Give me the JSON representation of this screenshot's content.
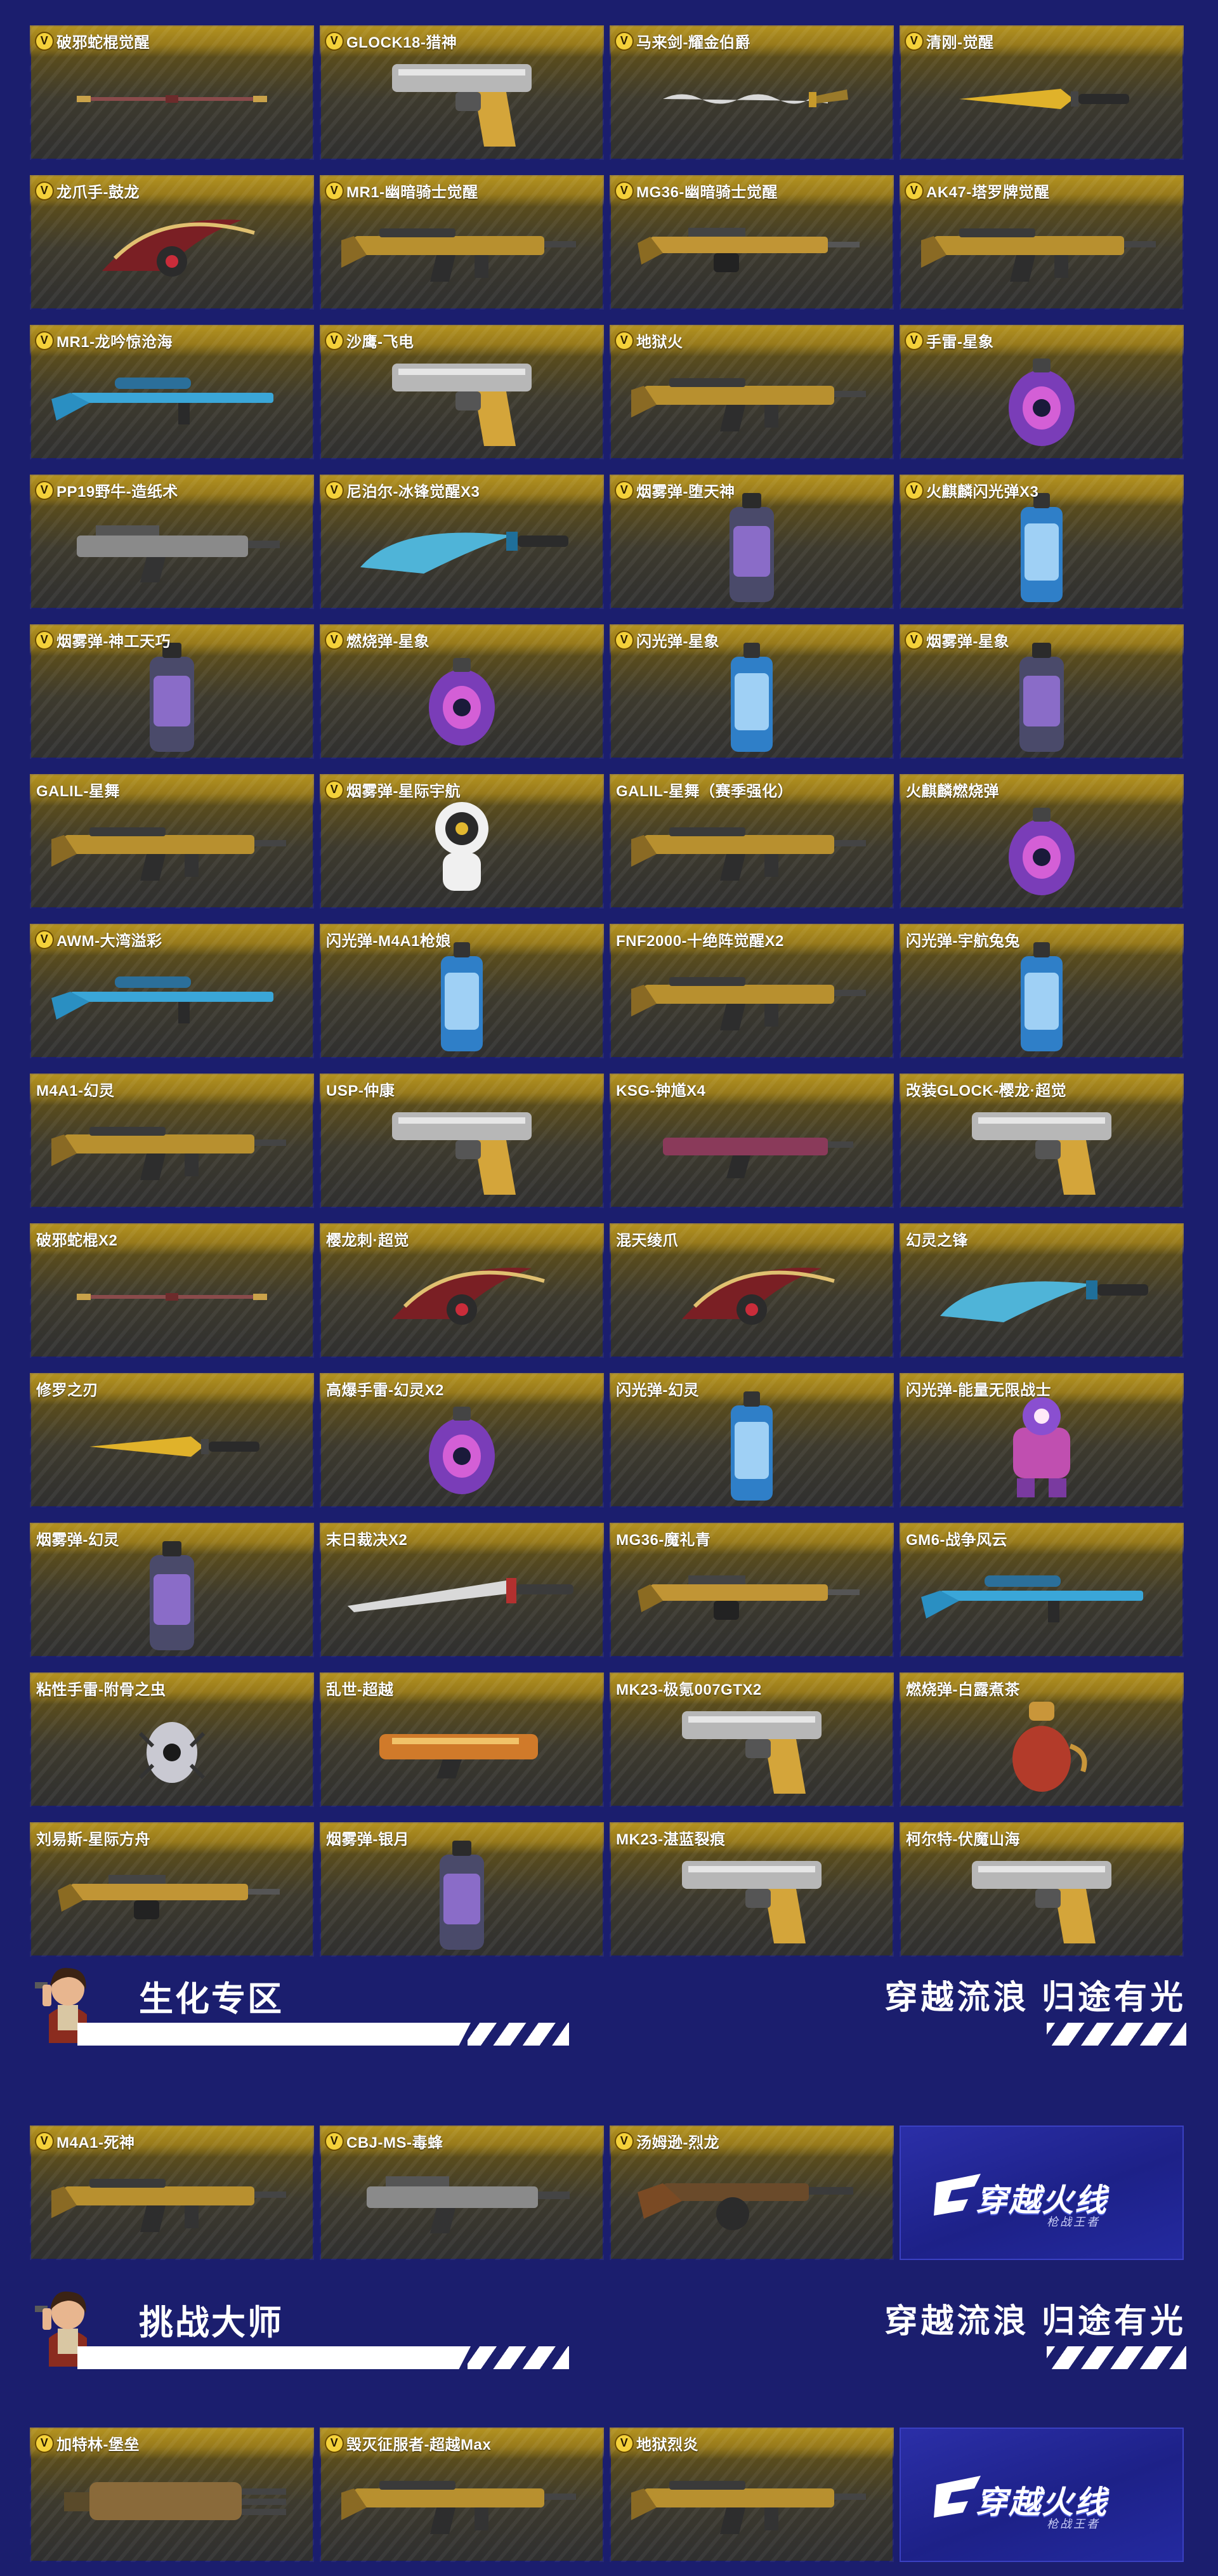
{
  "colors": {
    "background": "#1b1e6e",
    "card_gold": "#c8a224",
    "badge": "#f4d13a"
  },
  "items": [
    {
      "name": "破邪蛇棍觉醒",
      "v": true,
      "icon": "staff-icon"
    },
    {
      "name": "GLOCK18-猎神",
      "v": true,
      "icon": "pistol-icon"
    },
    {
      "name": "马来剑-耀金伯爵",
      "v": true,
      "icon": "kris-sword-icon"
    },
    {
      "name": "清刚-觉醒",
      "v": true,
      "icon": "knife-icon"
    },
    {
      "name": "龙爪手-鼓龙",
      "v": true,
      "icon": "claw-icon"
    },
    {
      "name": "MR1-幽暗骑士觉醒",
      "v": true,
      "icon": "rifle-icon"
    },
    {
      "name": "MG36-幽暗骑士觉醒",
      "v": true,
      "icon": "machine-gun-icon"
    },
    {
      "name": "AK47-塔罗牌觉醒",
      "v": true,
      "icon": "rifle-icon"
    },
    {
      "name": "MR1-龙吟惊沧海",
      "v": true,
      "icon": "sniper-icon"
    },
    {
      "name": "沙鹰-飞电",
      "v": true,
      "icon": "pistol-icon"
    },
    {
      "name": "地狱火",
      "v": true,
      "icon": "rifle-icon"
    },
    {
      "name": "手雷-星象",
      "v": true,
      "icon": "grenade-icon"
    },
    {
      "name": "PP19野牛-造纸术",
      "v": true,
      "icon": "smg-icon"
    },
    {
      "name": "尼泊尔-冰锋觉醒X3",
      "v": true,
      "icon": "machete-icon"
    },
    {
      "name": "烟雾弹-堕天神",
      "v": true,
      "icon": "smoke-grenade-icon"
    },
    {
      "name": "火麒麟闪光弹X3",
      "v": true,
      "icon": "flash-grenade-icon"
    },
    {
      "name": "烟雾弹-神工天巧",
      "v": true,
      "icon": "smoke-grenade-icon"
    },
    {
      "name": "燃烧弹-星象",
      "v": true,
      "icon": "grenade-icon"
    },
    {
      "name": "闪光弹-星象",
      "v": true,
      "icon": "flash-grenade-icon"
    },
    {
      "name": "烟雾弹-星象",
      "v": true,
      "icon": "smoke-grenade-icon"
    },
    {
      "name": "GALIL-星舞",
      "v": false,
      "icon": "rifle-icon"
    },
    {
      "name": "烟雾弹-星际宇航",
      "v": true,
      "icon": "astronaut-icon"
    },
    {
      "name": "GALIL-星舞（赛季强化）",
      "v": false,
      "icon": "rifle-icon"
    },
    {
      "name": "火麒麟燃烧弹",
      "v": false,
      "icon": "grenade-icon"
    },
    {
      "name": "AWM-大湾溢彩",
      "v": true,
      "icon": "sniper-icon"
    },
    {
      "name": "闪光弹-M4A1枪娘",
      "v": false,
      "icon": "flash-grenade-icon"
    },
    {
      "name": "FNF2000-十绝阵觉醒X2",
      "v": false,
      "icon": "rifle-icon"
    },
    {
      "name": "闪光弹-宇航兔兔",
      "v": false,
      "icon": "flash-grenade-icon"
    },
    {
      "name": "M4A1-幻灵",
      "v": false,
      "icon": "rifle-icon"
    },
    {
      "name": "USP-仲康",
      "v": false,
      "icon": "pistol-icon"
    },
    {
      "name": "KSG-钟馗X4",
      "v": false,
      "icon": "shotgun-icon"
    },
    {
      "name": "改装GLOCK-樱龙·超觉",
      "v": false,
      "icon": "pistol-icon"
    },
    {
      "name": "破邪蛇棍X2",
      "v": false,
      "icon": "staff-icon"
    },
    {
      "name": "樱龙刺·超觉",
      "v": false,
      "icon": "claw-icon"
    },
    {
      "name": "混天绫爪",
      "v": false,
      "icon": "claw-icon"
    },
    {
      "name": "幻灵之锋",
      "v": false,
      "icon": "machete-icon"
    },
    {
      "name": "修罗之刃",
      "v": false,
      "icon": "knife-icon"
    },
    {
      "name": "高爆手雷-幻灵X2",
      "v": false,
      "icon": "grenade-icon"
    },
    {
      "name": "闪光弹-幻灵",
      "v": false,
      "icon": "flash-grenade-icon"
    },
    {
      "name": "闪光弹-能量无限战士",
      "v": false,
      "icon": "robot-icon"
    },
    {
      "name": "烟雾弹-幻灵",
      "v": false,
      "icon": "smoke-grenade-icon"
    },
    {
      "name": "末日裁决X2",
      "v": false,
      "icon": "sword-icon"
    },
    {
      "name": "MG36-魔礼青",
      "v": false,
      "icon": "machine-gun-icon"
    },
    {
      "name": "GM6-战争风云",
      "v": false,
      "icon": "sniper-icon"
    },
    {
      "name": "粘性手雷-附骨之虫",
      "v": false,
      "icon": "bug-grenade-icon"
    },
    {
      "name": "乱世-超越",
      "v": false,
      "icon": "launcher-icon"
    },
    {
      "name": "MK23-极氪007GTX2",
      "v": false,
      "icon": "pistol-icon"
    },
    {
      "name": "燃烧弹-白露煮茶",
      "v": false,
      "icon": "teapot-icon"
    },
    {
      "name": "刘易斯-星际方舟",
      "v": false,
      "icon": "machine-gun-icon"
    },
    {
      "name": "烟雾弹-银月",
      "v": false,
      "icon": "smoke-grenade-icon"
    },
    {
      "name": "MK23-湛蓝裂痕",
      "v": false,
      "icon": "pistol-icon"
    },
    {
      "name": "柯尔特-伏魔山海",
      "v": false,
      "icon": "pistol-icon"
    }
  ],
  "sections": [
    {
      "title": "生化专区",
      "slogan": "穿越流浪 归途有光",
      "items": [
        {
          "name": "M4A1-死神",
          "v": true,
          "icon": "rifle-icon"
        },
        {
          "name": "CBJ-MS-毒蜂",
          "v": true,
          "icon": "smg-icon"
        },
        {
          "name": "汤姆逊-烈龙",
          "v": true,
          "icon": "tommy-gun-icon"
        }
      ],
      "logo": {
        "main": "穿越火线",
        "sub": "枪战王者"
      }
    },
    {
      "title": "挑战大师",
      "slogan": "穿越流浪 归途有光",
      "items": [
        {
          "name": "加特林-堡垒",
          "v": true,
          "icon": "gatling-icon"
        },
        {
          "name": "毁灭征服者-超越Max",
          "v": true,
          "icon": "rifle-icon"
        },
        {
          "name": "地狱烈炎",
          "v": true,
          "icon": "rifle-icon"
        }
      ],
      "logo": {
        "main": "穿越火线",
        "sub": "枪战王者"
      }
    }
  ]
}
